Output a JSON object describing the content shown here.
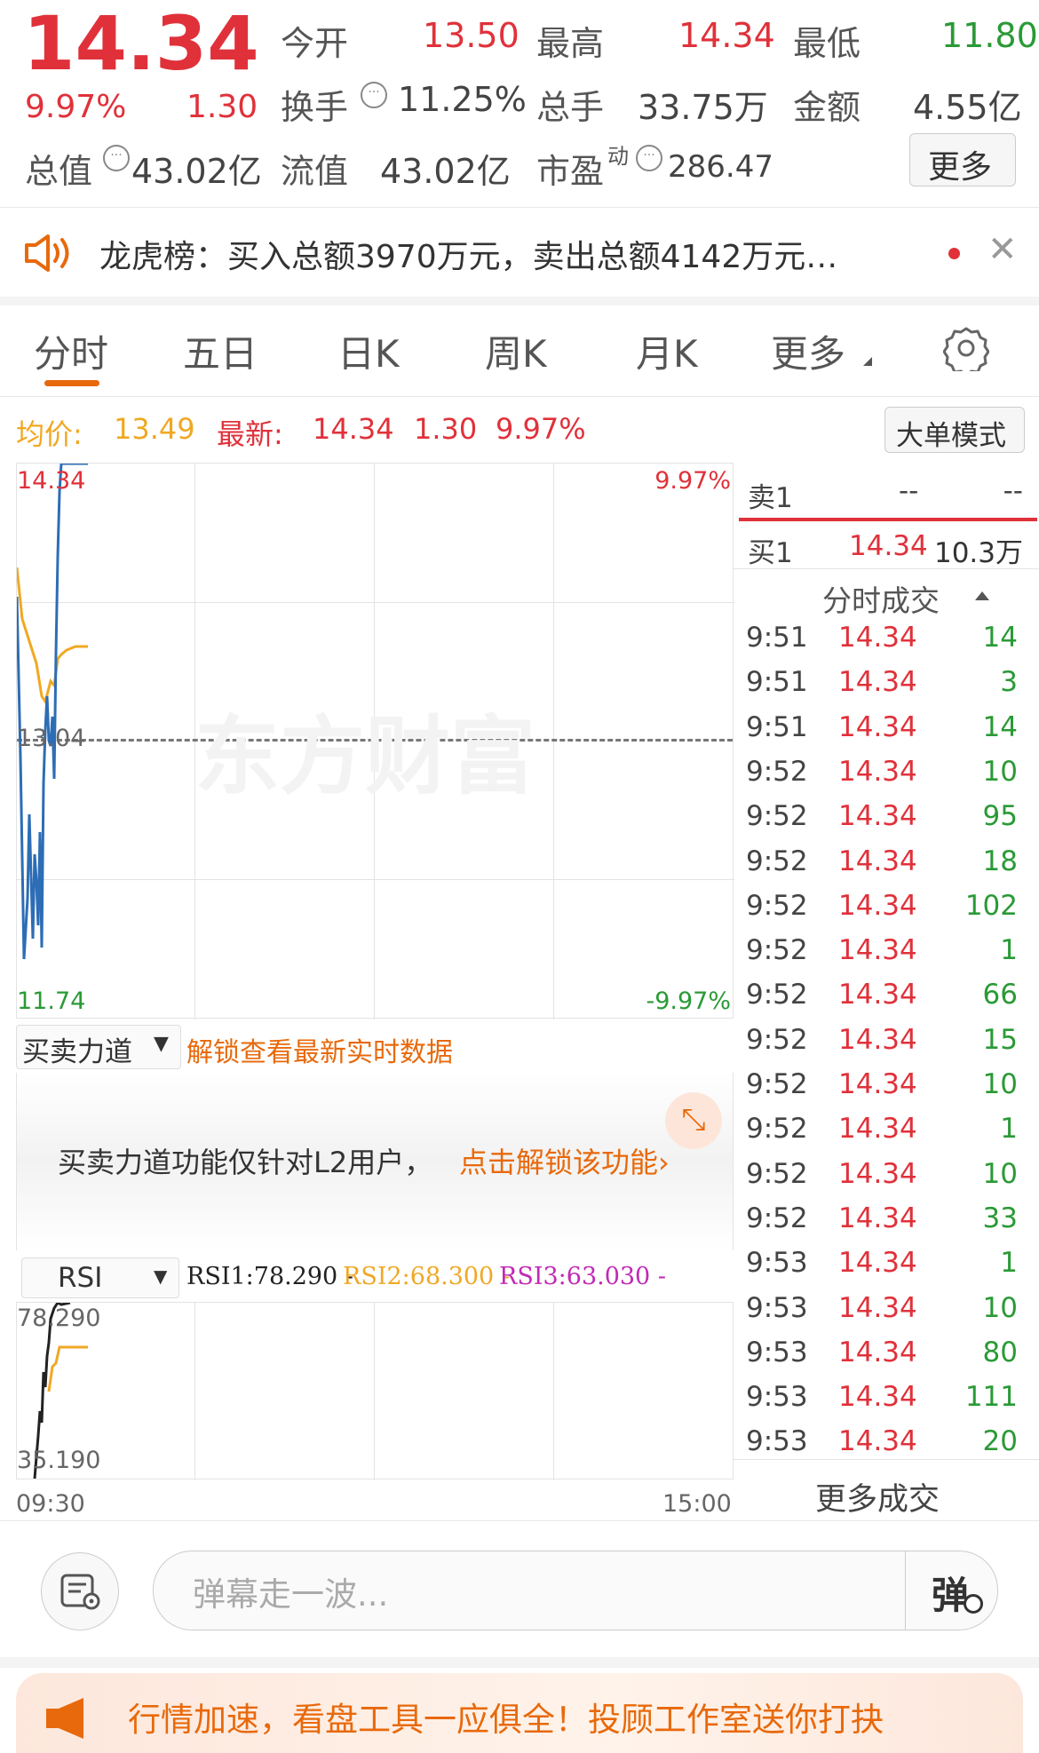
{
  "header": {
    "price": "14.34",
    "change_pct": "9.97%",
    "change_amt": "1.30",
    "open_label": "今开",
    "open_value": "13.50",
    "high_label": "最高",
    "high_value": "14.34",
    "low_label": "最低",
    "low_value": "11.80",
    "turnover_label": "换手",
    "turnover_value": "11.25%",
    "volume_label": "总手",
    "volume_value": "33.75万",
    "amount_label": "金额",
    "amount_value": "4.55亿",
    "mktcap_label": "总值",
    "mktcap_value": "43.02亿",
    "float_label": "流值",
    "float_value": "43.02亿",
    "pe_label": "市盈",
    "pe_sup": "动",
    "pe_value": "286.47",
    "more_button": "更多"
  },
  "notice": {
    "text": "龙虎榜：买入总额3970万元，卖出总额4142万元…"
  },
  "tabs": [
    "分时",
    "五日",
    "日K",
    "周K",
    "月K",
    "更多"
  ],
  "info_bar": {
    "avg_label": "均价:",
    "avg_value": "13.49",
    "latest_label": "最新:",
    "latest_value": "14.34",
    "latest_chg": "1.30",
    "latest_pct": "9.97%",
    "mode_button": "大单模式"
  },
  "chart_labels": {
    "top_price": "14.34",
    "top_pct": "9.97%",
    "mid_price": "13.04",
    "bottom_price": "11.74",
    "bottom_pct": "-9.97%",
    "watermark": "东方财富"
  },
  "indicator1": {
    "select": "买卖力道",
    "link": "解锁查看最新实时数据",
    "lock_text": "买卖力道功能仅针对L2用户，",
    "lock_link": "点击解锁该功能"
  },
  "indicator2": {
    "select": "RSI",
    "rsi1": "RSI1:78.290 -",
    "rsi2": "RSI2:68.300 -",
    "rsi3": "RSI3:63.030 -",
    "top": "78.290",
    "bottom": "35.190",
    "time_start": "09:30",
    "time_end": "15:00"
  },
  "orderbook": {
    "sell1_label": "卖1",
    "sell1_price": "--",
    "sell1_vol": "--",
    "buy1_label": "买1",
    "buy1_price": "14.34",
    "buy1_vol": "10.3万"
  },
  "trades": {
    "title": "分时成交",
    "rows": [
      {
        "time": "9:51",
        "price": "14.34",
        "vol": "14"
      },
      {
        "time": "9:51",
        "price": "14.34",
        "vol": "3"
      },
      {
        "time": "9:51",
        "price": "14.34",
        "vol": "14"
      },
      {
        "time": "9:52",
        "price": "14.34",
        "vol": "10"
      },
      {
        "time": "9:52",
        "price": "14.34",
        "vol": "95"
      },
      {
        "time": "9:52",
        "price": "14.34",
        "vol": "18"
      },
      {
        "time": "9:52",
        "price": "14.34",
        "vol": "102"
      },
      {
        "time": "9:52",
        "price": "14.34",
        "vol": "1"
      },
      {
        "time": "9:52",
        "price": "14.34",
        "vol": "66"
      },
      {
        "time": "9:52",
        "price": "14.34",
        "vol": "15"
      },
      {
        "time": "9:52",
        "price": "14.34",
        "vol": "10"
      },
      {
        "time": "9:52",
        "price": "14.34",
        "vol": "1"
      },
      {
        "time": "9:52",
        "price": "14.34",
        "vol": "10"
      },
      {
        "time": "9:52",
        "price": "14.34",
        "vol": "33"
      },
      {
        "time": "9:53",
        "price": "14.34",
        "vol": "1"
      },
      {
        "time": "9:53",
        "price": "14.34",
        "vol": "10"
      },
      {
        "time": "9:53",
        "price": "14.34",
        "vol": "80"
      },
      {
        "time": "9:53",
        "price": "14.34",
        "vol": "111"
      },
      {
        "time": "9:53",
        "price": "14.34",
        "vol": "20"
      }
    ],
    "more": "更多成交"
  },
  "comment": {
    "placeholder": "弹幕走一波...",
    "send_label": "弹"
  },
  "promo": {
    "text": "行情加速，看盘工具一应俱全！投顾工作室送你打抉"
  },
  "colors": {
    "up": "#e0313a",
    "down": "#2a9a36",
    "accent": "#e8690b",
    "avg_line": "#f0a823",
    "price_line": "#2d6db5"
  }
}
